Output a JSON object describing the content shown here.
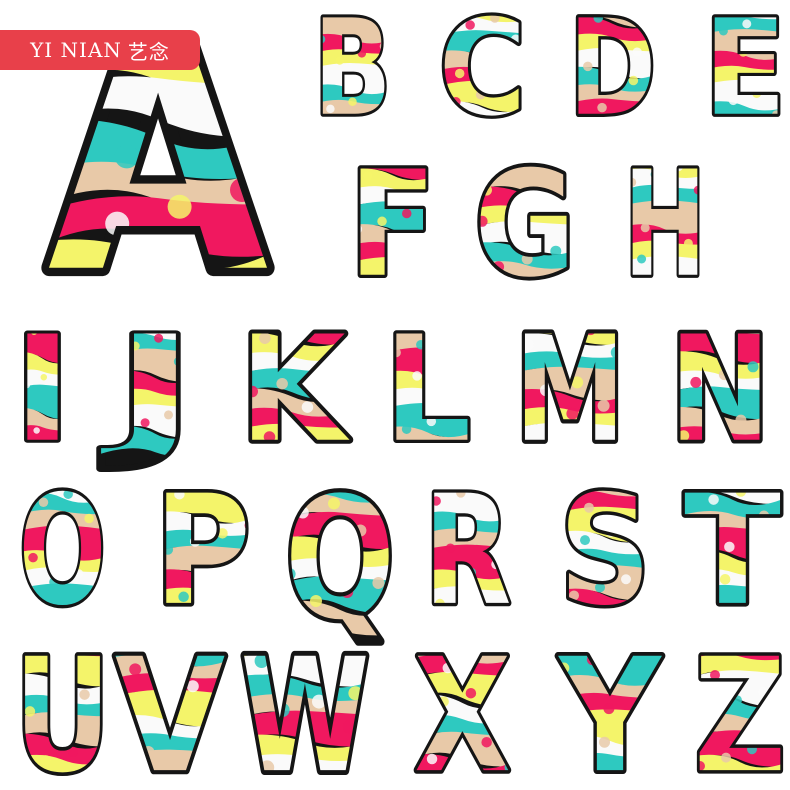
{
  "brand": {
    "latin": "YI NIAN",
    "chinese": "艺念",
    "color": "#e8404a"
  },
  "palette": {
    "pink": "#f0185f",
    "teal": "#2ec9c0",
    "yellow": "#f4f46a",
    "tan": "#e8c9a8",
    "white": "#fafafa",
    "border": "#151515"
  },
  "letters": [
    "A",
    "B",
    "C",
    "D",
    "E",
    "F",
    "G",
    "H",
    "I",
    "J",
    "K",
    "L",
    "M",
    "N",
    "O",
    "P",
    "Q",
    "R",
    "S",
    "T",
    "U",
    "V",
    "W",
    "X",
    "Y",
    "Z"
  ]
}
